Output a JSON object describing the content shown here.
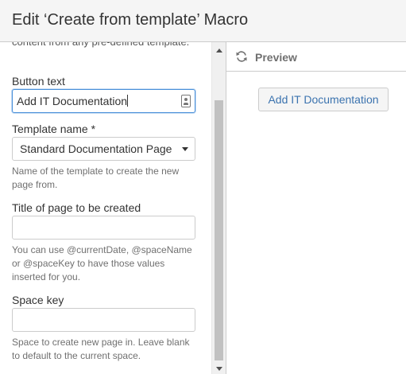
{
  "dialog": {
    "title": "Edit ‘Create from template’ Macro"
  },
  "form": {
    "intro_description": "content from any pre-defined template.",
    "button_text": {
      "label": "Button text",
      "value": "Add IT Documentation"
    },
    "template_name": {
      "label": "Template name *",
      "selected": "Standard Documentation Page",
      "help": "Name of the template to create the new page from."
    },
    "page_title": {
      "label": "Title of page to be created",
      "value": "",
      "help": "You can use @currentDate, @spaceName or @spaceKey to have those values inserted for you."
    },
    "space_key": {
      "label": "Space key",
      "value": "",
      "help": "Space to create new page in. Leave blank to default to the current space."
    }
  },
  "preview": {
    "label": "Preview",
    "icon": "refresh-icon",
    "button_label": "Add IT Documentation"
  },
  "colors": {
    "header_bg": "#f5f5f5",
    "link_blue": "#3b73af",
    "focus_border": "#4a90d9"
  }
}
